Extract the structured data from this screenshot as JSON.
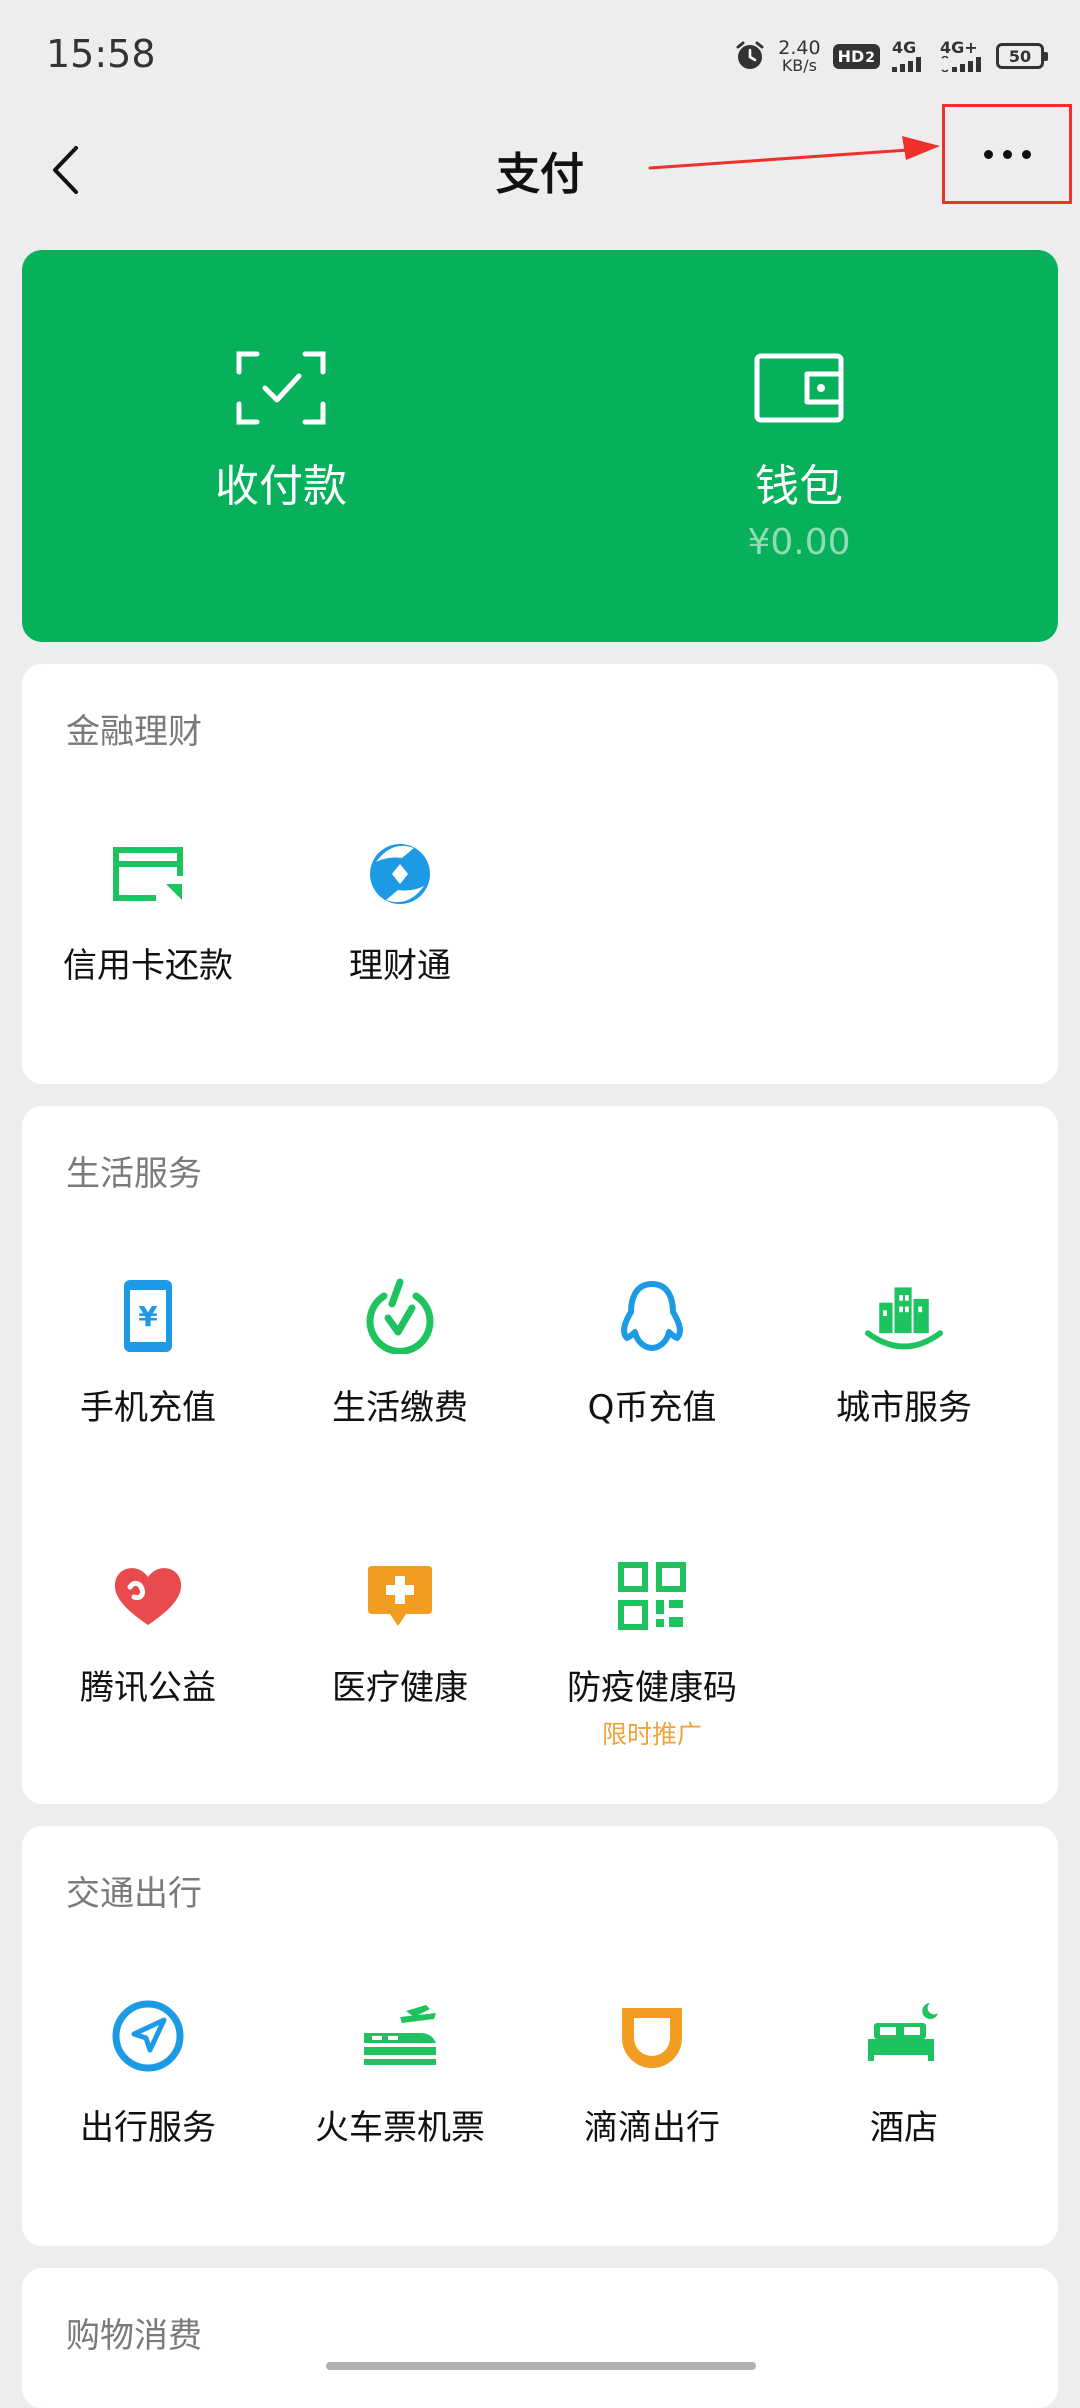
{
  "status": {
    "time": "15:58",
    "net_speed_value": "2.40",
    "net_speed_unit": "KB/s",
    "hd_label": "HD",
    "hd_sub": "2",
    "sim1_label": "4G",
    "sim2_label": "4G+",
    "battery": "50"
  },
  "nav": {
    "title": "支付"
  },
  "hero": {
    "pay_label": "收付款",
    "wallet_label": "钱包",
    "wallet_balance": "¥0.00"
  },
  "sections": {
    "finance": {
      "title": "金融理财",
      "items": [
        {
          "label": "信用卡还款"
        },
        {
          "label": "理财通"
        }
      ]
    },
    "life": {
      "title": "生活服务",
      "items": [
        {
          "label": "手机充值"
        },
        {
          "label": "生活缴费"
        },
        {
          "label": "Q币充值"
        },
        {
          "label": "城市服务"
        },
        {
          "label": "腾讯公益"
        },
        {
          "label": "医疗健康"
        },
        {
          "label": "防疫健康码",
          "badge": "限时推广"
        }
      ]
    },
    "transport": {
      "title": "交通出行",
      "items": [
        {
          "label": "出行服务"
        },
        {
          "label": "火车票机票"
        },
        {
          "label": "滴滴出行"
        },
        {
          "label": "酒店"
        }
      ]
    },
    "shopping": {
      "title": "购物消费"
    }
  },
  "colors": {
    "wechat_green": "#07b05b",
    "icon_green": "#1ec25f",
    "icon_blue": "#1d9ae6",
    "icon_orange": "#f29c20",
    "icon_red": "#e84a4d",
    "badge_orange": "#f0a23b",
    "annotation_red": "#f1302b"
  }
}
